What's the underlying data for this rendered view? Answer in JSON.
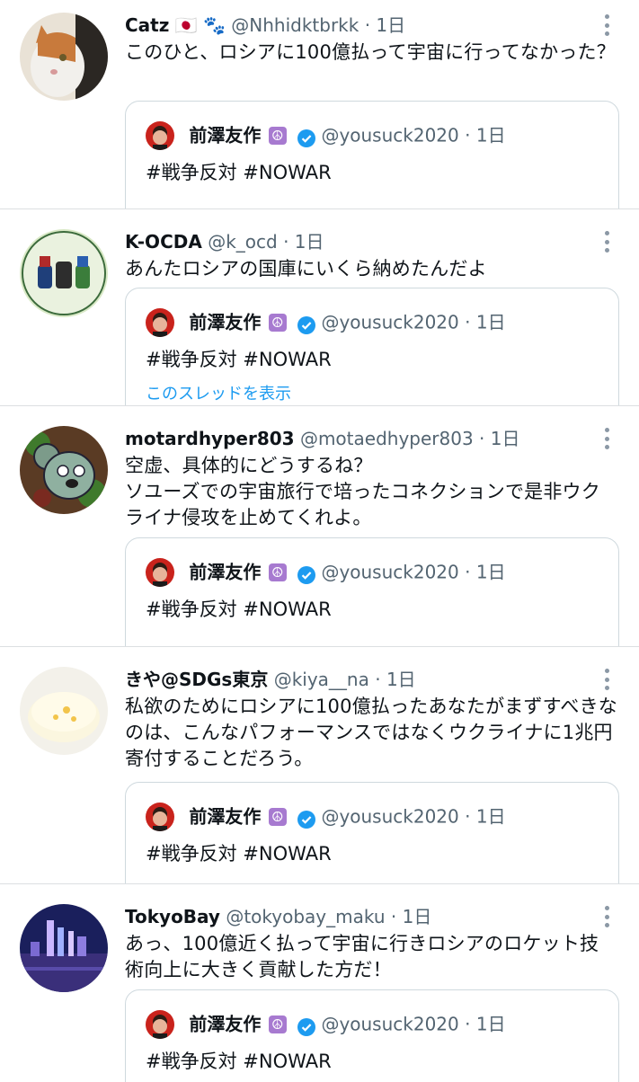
{
  "more_icon": "more-vertical-icon",
  "colors": {
    "secondary": "#536471",
    "link": "#1d9bf0",
    "border": "#cfd9de",
    "peace_badge": "#a77ad0",
    "verified": "#1d9bf0"
  },
  "quoted": {
    "name": "前澤友作",
    "peace_emoji": "☮",
    "handle": "@yousuck2020",
    "time": "1日",
    "text": "#戦争反対 #NOWAR",
    "thread_link": "このスレッドを表示"
  },
  "tweets": [
    {
      "name": "Catz",
      "emojis": "🇯🇵 🐾",
      "handle": "@Nhhidktbrkk",
      "time": "1日",
      "text": "このひと、ロシアに100億払って宇宙に行ってなかった？"
    },
    {
      "name": "K-OCDA",
      "handle": "@k_ocd",
      "time": "1日",
      "text": "あんたロシアの国庫にいくら納めたんだよ"
    },
    {
      "name": "motardhyper803",
      "handle": "@motaedhyper803",
      "time": "1日",
      "text": "空虚、具体的にどうするね？\nソユーズでの宇宙旅行で培ったコネクションで是非ウクライナ侵攻を止めてくれよ。"
    },
    {
      "name": "きや@SDGs東京",
      "handle": "@kiya__na",
      "time": "1日",
      "text": "私欲のためにロシアに100億払ったあなたがまずすべきなのは、こんなパフォーマンスではなくウクライナに1兆円寄付することだろう。"
    },
    {
      "name": "TokyoBay",
      "handle": "@tokyobay_maku",
      "time": "1日",
      "text": "あっ、100億近く払って宇宙に行きロシアのロケット技術向上に大きく貢献した方だ！"
    }
  ]
}
